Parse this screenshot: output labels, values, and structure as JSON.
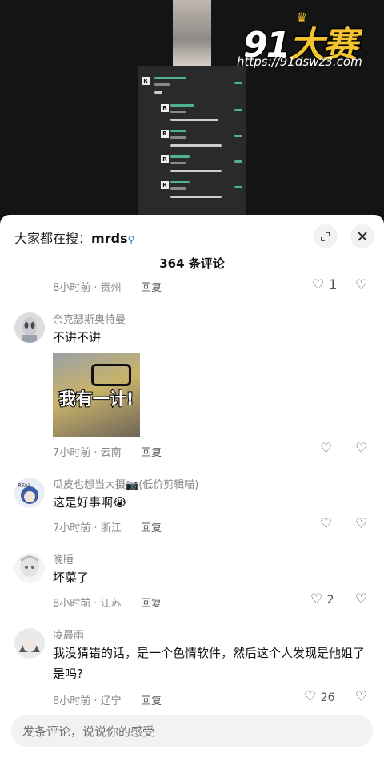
{
  "header": {
    "search_prefix": "大家都在搜：",
    "search_term": "mrds",
    "comment_count": "364 条评论"
  },
  "watermark": {
    "brand_white": "91",
    "brand_gold": "大赛",
    "url": "https://91dswz3.com"
  },
  "partial_row": {
    "meta": "8小时前 · 贵州",
    "reply": "回复",
    "likes": "1"
  },
  "comments": [
    {
      "user": "奈克瑟斯奥特曼",
      "text": "不讲不讲",
      "meme_text": "我有一计!",
      "meta": "7小时前 · 云南",
      "reply": "回复",
      "likes": ""
    },
    {
      "user": "瓜皮也想当大摄📷(低价剪辑喵)",
      "text": "这是好事啊😭",
      "meta": "7小时前 · 浙江",
      "reply": "回复",
      "likes": ""
    },
    {
      "user": "晚睡",
      "text": "坏菜了",
      "meta": "8小时前 · 江苏",
      "reply": "回复",
      "likes": "2"
    },
    {
      "user": "凌晨雨",
      "text": "我没猜错的话，是一个色情软件，然后这个人发现是他姐了是吗?",
      "meta": "8小时前 · 辽宁",
      "reply": "回复",
      "likes": "26"
    }
  ],
  "input": {
    "placeholder": "发条评论，说说你的感受"
  },
  "icons": {
    "like": "heart-outline-icon",
    "dislike": "broken-heart-icon",
    "expand": "expand-icon",
    "close": "close-icon",
    "search": "search-icon"
  },
  "colors": {
    "gold": "#f4c430",
    "accent": "#3a6bd6"
  }
}
